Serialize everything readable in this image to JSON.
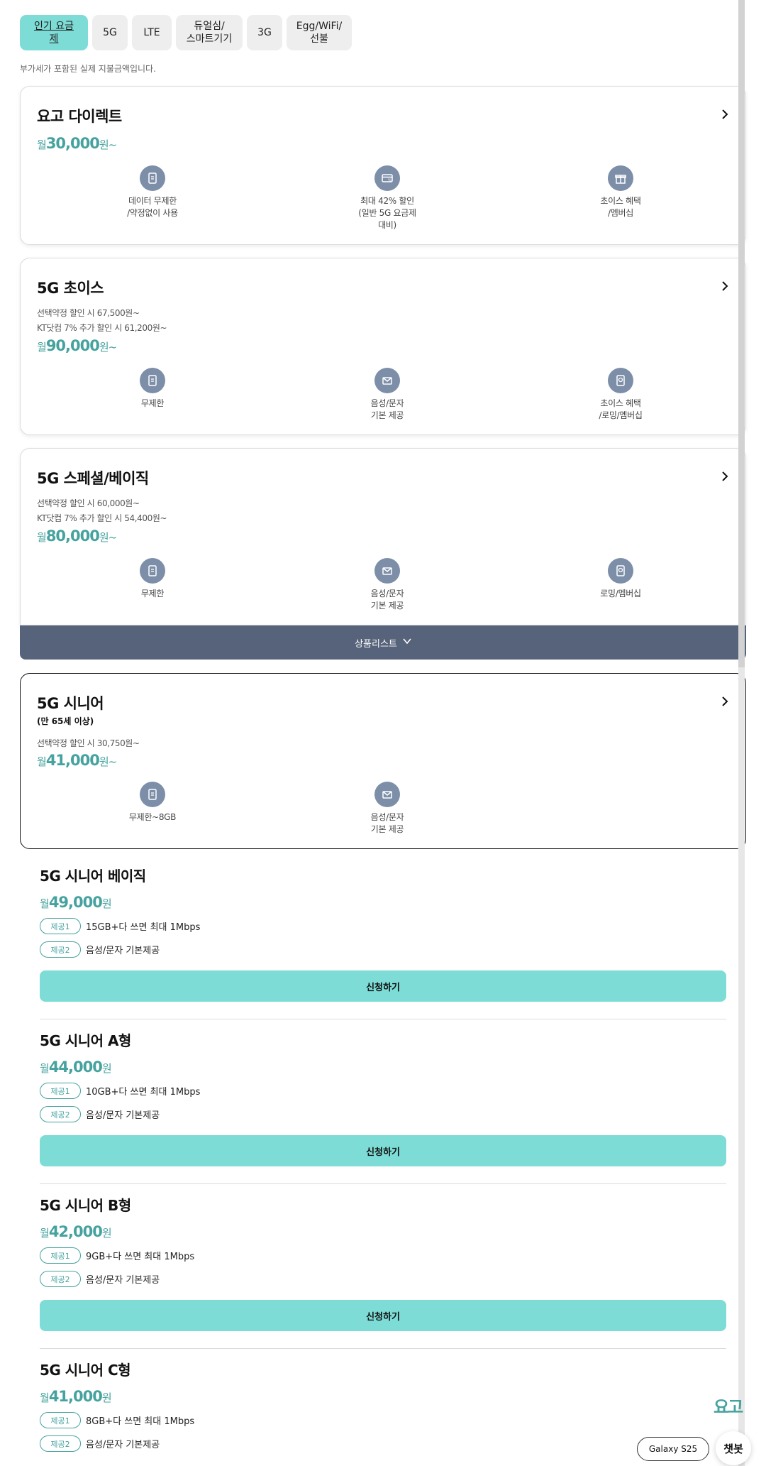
{
  "tabs": [
    {
      "label": "인기 요금제",
      "active": true
    },
    {
      "label": "5G",
      "active": false
    },
    {
      "label": "LTE",
      "active": false
    },
    {
      "label": "듀얼심/\n스마트기기",
      "active": false
    },
    {
      "label": "3G",
      "active": false
    },
    {
      "label": "Egg/WiFi/\n선불",
      "active": false
    }
  ],
  "vat_note": "부가세가 포함된 실제 지불금액입니다.",
  "plans": [
    {
      "title": "요고 다이렉트",
      "price_prefix": "월",
      "price": "30,000",
      "price_suffix": "원~",
      "features": [
        {
          "icon": "data-icon",
          "label": "데이터 무제한\n/약정없이 사용"
        },
        {
          "icon": "discount-card-icon",
          "label": "최대 42% 할인\n(일반 5G 요금제\n대비)"
        },
        {
          "icon": "gift-icon",
          "label": "초이스 혜택\n/멤버십"
        }
      ]
    },
    {
      "title": "5G 초이스",
      "discount_1": "선택약정 할인 시 67,500원~",
      "discount_2": "KT닷컴 7% 추가 할인 시 61,200원~",
      "price_prefix": "월",
      "price": "90,000",
      "price_suffix": "원~",
      "features": [
        {
          "icon": "data-icon",
          "label": "무제한"
        },
        {
          "icon": "call-message-icon",
          "label": "음성/문자\n기본 제공"
        },
        {
          "icon": "roaming-membership-icon",
          "label": "초이스 혜택\n/로밍/멤버십"
        }
      ]
    },
    {
      "title": "5G 스페셜/베이직",
      "discount_1": "선택약정 할인 시 60,000원~",
      "discount_2": "KT닷컴 7% 추가 할인 시 54,400원~",
      "price_prefix": "월",
      "price": "80,000",
      "price_suffix": "원~",
      "features": [
        {
          "icon": "data-icon",
          "label": "무제한"
        },
        {
          "icon": "call-message-icon",
          "label": "음성/문자\n기본 제공"
        },
        {
          "icon": "roaming-membership-icon",
          "label": "로밍/멤버십"
        }
      ]
    },
    {
      "title": "5G 시니어",
      "subtitle": "(만 65세 이상)",
      "discount_1": "선택약정 할인 시 30,750원~",
      "price_prefix": "월",
      "price": "41,000",
      "price_suffix": "원~",
      "features": [
        {
          "icon": "data-icon",
          "label": "무제한~8GB"
        },
        {
          "icon": "call-message-icon",
          "label": "음성/문자\n기본 제공"
        }
      ]
    }
  ],
  "product_list_label": "상품리스트",
  "products": [
    {
      "name": "5G 시니어 베이직",
      "price_prefix": "월",
      "price": "49,000",
      "price_suffix": "원",
      "offers": [
        {
          "badge": "제공1",
          "text": "15GB+다 쓰면 최대 1Mbps"
        },
        {
          "badge": "제공2",
          "text": "음성/문자 기본제공"
        }
      ],
      "apply_label": "신청하기"
    },
    {
      "name": "5G 시니어 A형",
      "price_prefix": "월",
      "price": "44,000",
      "price_suffix": "원",
      "offers": [
        {
          "badge": "제공1",
          "text": "10GB+다 쓰면 최대 1Mbps"
        },
        {
          "badge": "제공2",
          "text": "음성/문자 기본제공"
        }
      ],
      "apply_label": "신청하기"
    },
    {
      "name": "5G 시니어 B형",
      "price_prefix": "월",
      "price": "42,000",
      "price_suffix": "원",
      "offers": [
        {
          "badge": "제공1",
          "text": "9GB+다 쓰면 최대 1Mbps"
        },
        {
          "badge": "제공2",
          "text": "음성/문자 기본제공"
        }
      ],
      "apply_label": "신청하기"
    },
    {
      "name": "5G 시니어 C형",
      "price_prefix": "월",
      "price": "41,000",
      "price_suffix": "원",
      "offers": [
        {
          "badge": "제공1",
          "text": "8GB+다 쓰면 최대 1Mbps"
        },
        {
          "badge": "제공2",
          "text": "음성/문자 기본제공"
        }
      ],
      "apply_label": "신청하기"
    }
  ],
  "floating": {
    "logo_text": "요고",
    "device_label": "Galaxy S25",
    "chatbot_label": "챗봇"
  },
  "colors": {
    "accent": "#7ddcd6",
    "price": "#45a29e",
    "bar": "#57637a",
    "icon_bg": "#7d8ea8"
  }
}
